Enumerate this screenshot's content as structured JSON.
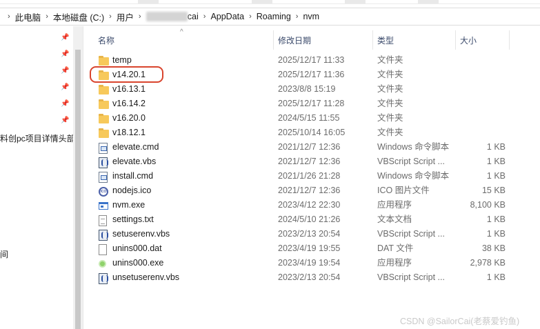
{
  "address": {
    "crumbs": [
      "此电脑",
      "本地磁盘 (C:)",
      "用户",
      "cai",
      "AppData",
      "Roaming",
      "nvm"
    ]
  },
  "nav": {
    "items": [
      "料创pc项目详情头部",
      "间"
    ]
  },
  "columns": {
    "name": "名称",
    "date": "修改日期",
    "type": "类型",
    "size": "大小"
  },
  "files": [
    {
      "name": "temp",
      "date": "2025/12/17 11:33",
      "type": "文件夹",
      "size": "",
      "icon": "folder-icon"
    },
    {
      "name": "v14.20.1",
      "date": "2025/12/17 11:36",
      "type": "文件夹",
      "size": "",
      "icon": "folder-icon"
    },
    {
      "name": "v16.13.1",
      "date": "2023/8/8 15:19",
      "type": "文件夹",
      "size": "",
      "icon": "folder-icon"
    },
    {
      "name": "v16.14.2",
      "date": "2025/12/17 11:28",
      "type": "文件夹",
      "size": "",
      "icon": "folder-icon"
    },
    {
      "name": "v16.20.0",
      "date": "2024/5/15 11:55",
      "type": "文件夹",
      "size": "",
      "icon": "folder-icon"
    },
    {
      "name": "v18.12.1",
      "date": "2025/10/14 16:05",
      "type": "文件夹",
      "size": "",
      "icon": "folder-icon"
    },
    {
      "name": "elevate.cmd",
      "date": "2021/12/7 12:36",
      "type": "Windows 命令脚本",
      "size": "1 KB",
      "icon": "cmd-script-icon"
    },
    {
      "name": "elevate.vbs",
      "date": "2021/12/7 12:36",
      "type": "VBScript Script ...",
      "size": "1 KB",
      "icon": "vbs-script-icon"
    },
    {
      "name": "install.cmd",
      "date": "2021/1/26 21:28",
      "type": "Windows 命令脚本",
      "size": "1 KB",
      "icon": "cmd-script-icon"
    },
    {
      "name": "nodejs.ico",
      "date": "2021/12/7 12:36",
      "type": "ICO 图片文件",
      "size": "15 KB",
      "icon": "ico-file-icon"
    },
    {
      "name": "nvm.exe",
      "date": "2023/4/12 22:30",
      "type": "应用程序",
      "size": "8,100 KB",
      "icon": "exe-app-icon"
    },
    {
      "name": "settings.txt",
      "date": "2024/5/10 21:26",
      "type": "文本文档",
      "size": "1 KB",
      "icon": "text-document-icon"
    },
    {
      "name": "setuserenv.vbs",
      "date": "2023/2/13 20:54",
      "type": "VBScript Script ...",
      "size": "1 KB",
      "icon": "vbs-script-icon"
    },
    {
      "name": "unins000.dat",
      "date": "2023/4/19 19:55",
      "type": "DAT 文件",
      "size": "38 KB",
      "icon": "blank-file-icon"
    },
    {
      "name": "unins000.exe",
      "date": "2023/4/19 19:54",
      "type": "应用程序",
      "size": "2,978 KB",
      "icon": "uninstaller-icon"
    },
    {
      "name": "unsetuserenv.vbs",
      "date": "2023/2/13 20:54",
      "type": "VBScript Script ...",
      "size": "1 KB",
      "icon": "vbs-script-icon"
    }
  ],
  "watermark": "CSDN @SailorCai(老蔡爱钓鱼)",
  "colors": {
    "highlight_ring": "#d9442d",
    "folder": "#f7c95b",
    "header_text": "#3b4a6b"
  }
}
